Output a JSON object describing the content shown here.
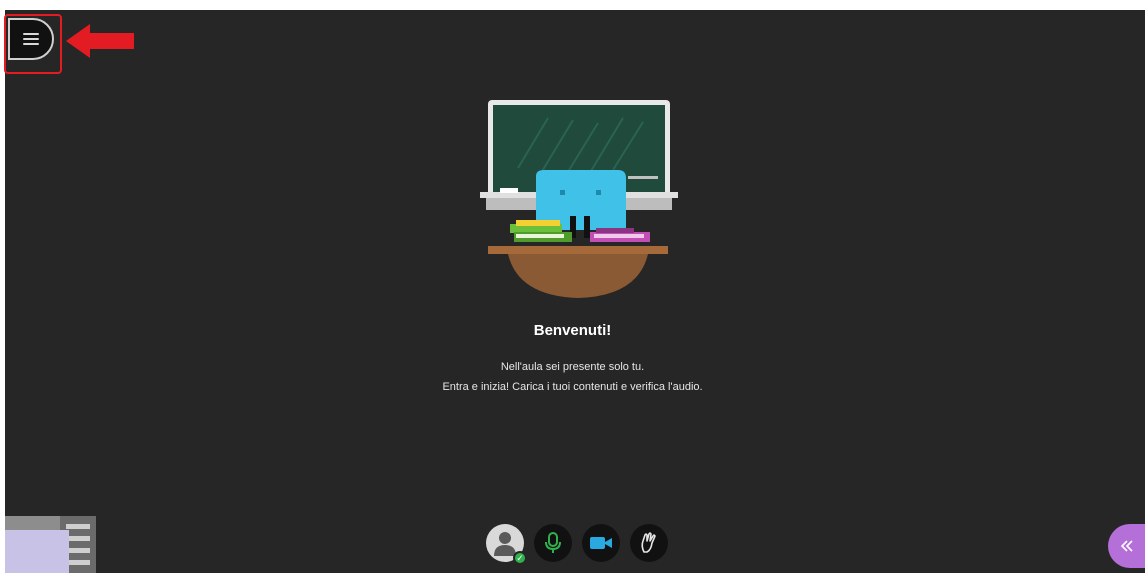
{
  "welcome": {
    "title": "Benvenuti!",
    "line1": "Nell'aula sei presente solo tu.",
    "line2": "Entra e inizia! Carica i tuoi contenuti e verifica l'audio."
  },
  "icons": {
    "menu": "hamburger-menu-icon",
    "arrow": "red-arrow-left-icon",
    "avatar": "user-avatar-icon",
    "mic": "microphone-icon",
    "camera": "video-camera-icon",
    "hand": "raise-hand-icon",
    "collab": "double-chevron-left-icon"
  },
  "colors": {
    "stage": "#262626",
    "highlight": "#e31b23",
    "mic": "#2fb24c",
    "camera": "#29a9e0",
    "collab_panel": "#b56fd8"
  }
}
